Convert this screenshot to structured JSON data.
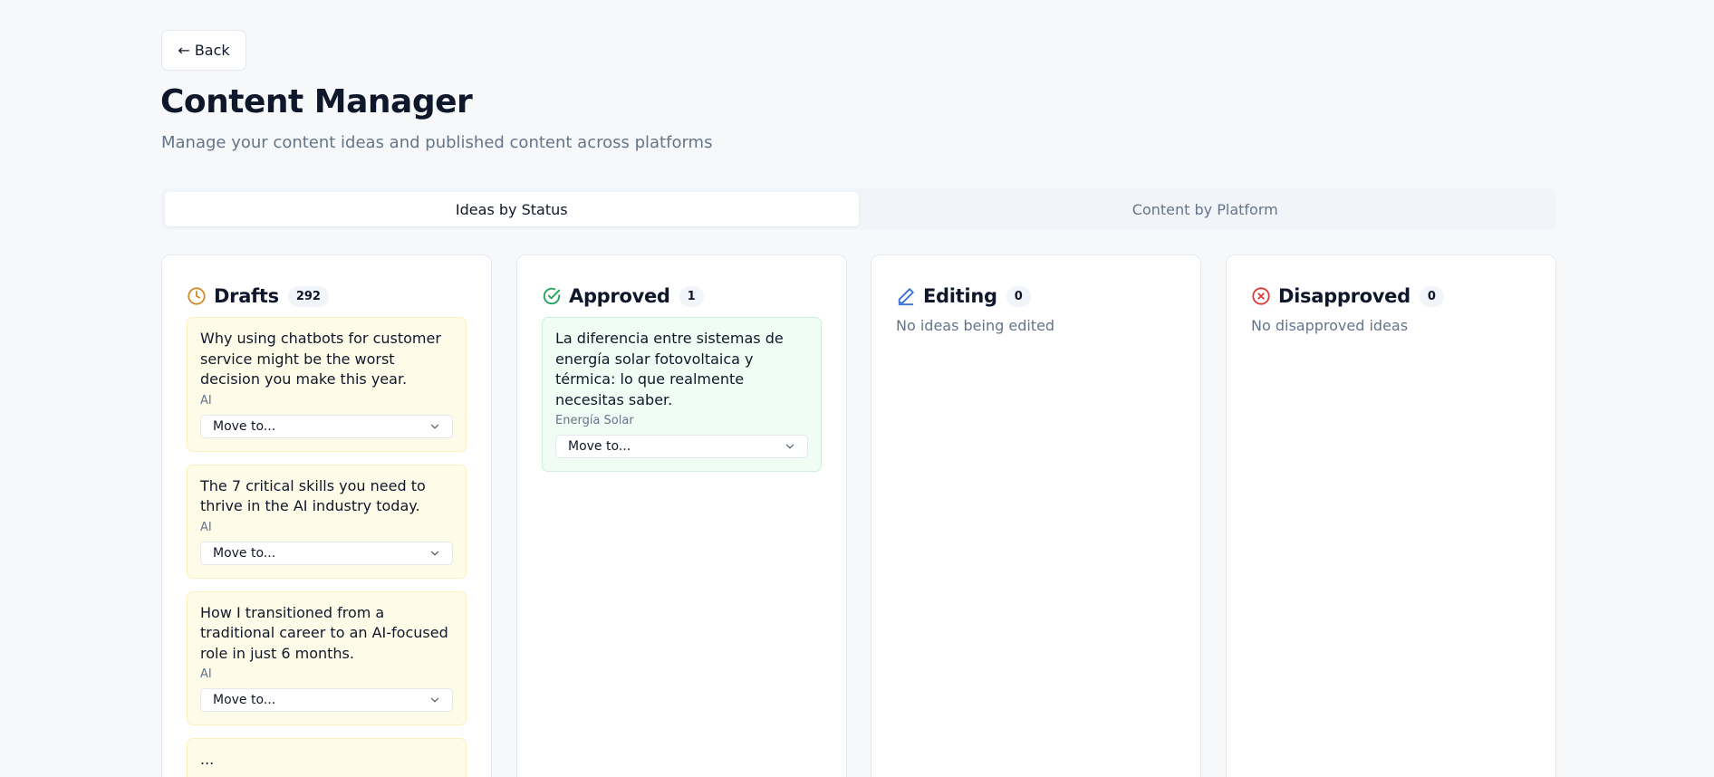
{
  "header": {
    "back_label": "← Back",
    "title": "Content Manager",
    "subtitle": "Manage your content ideas and published content across platforms"
  },
  "tabs": [
    {
      "label": "Ideas by Status",
      "active": true
    },
    {
      "label": "Content by Platform",
      "active": false
    }
  ],
  "columns": {
    "drafts": {
      "title": "Drafts",
      "count": "292",
      "icon": "clock-icon",
      "color": "#d08c2c",
      "cards": [
        {
          "title": "Why using chatbots for customer service might be the worst decision you make this year.",
          "tag": "AI",
          "move_label": "Move to..."
        },
        {
          "title": "The 7 critical skills you need to thrive in the AI industry today.",
          "tag": "AI",
          "move_label": "Move to..."
        },
        {
          "title": "How I transitioned from a traditional career to an AI-focused role in just 6 months.",
          "tag": "AI",
          "move_label": "Move to..."
        },
        {
          "title": "...",
          "tag": "",
          "move_label": ""
        }
      ]
    },
    "approved": {
      "title": "Approved",
      "count": "1",
      "icon": "check-circle-icon",
      "color": "#22a35a",
      "cards": [
        {
          "title": "La diferencia entre sistemas de energía solar fotovoltaica y térmica: lo que realmente necesitas saber.",
          "tag": "Energía Solar",
          "move_label": "Move to..."
        }
      ]
    },
    "editing": {
      "title": "Editing",
      "count": "0",
      "icon": "pencil-icon",
      "color": "#3b6fd8",
      "empty_text": "No ideas being edited"
    },
    "disapproved": {
      "title": "Disapproved",
      "count": "0",
      "icon": "x-circle-icon",
      "color": "#dc3a3a",
      "empty_text": "No disapproved ideas"
    }
  }
}
